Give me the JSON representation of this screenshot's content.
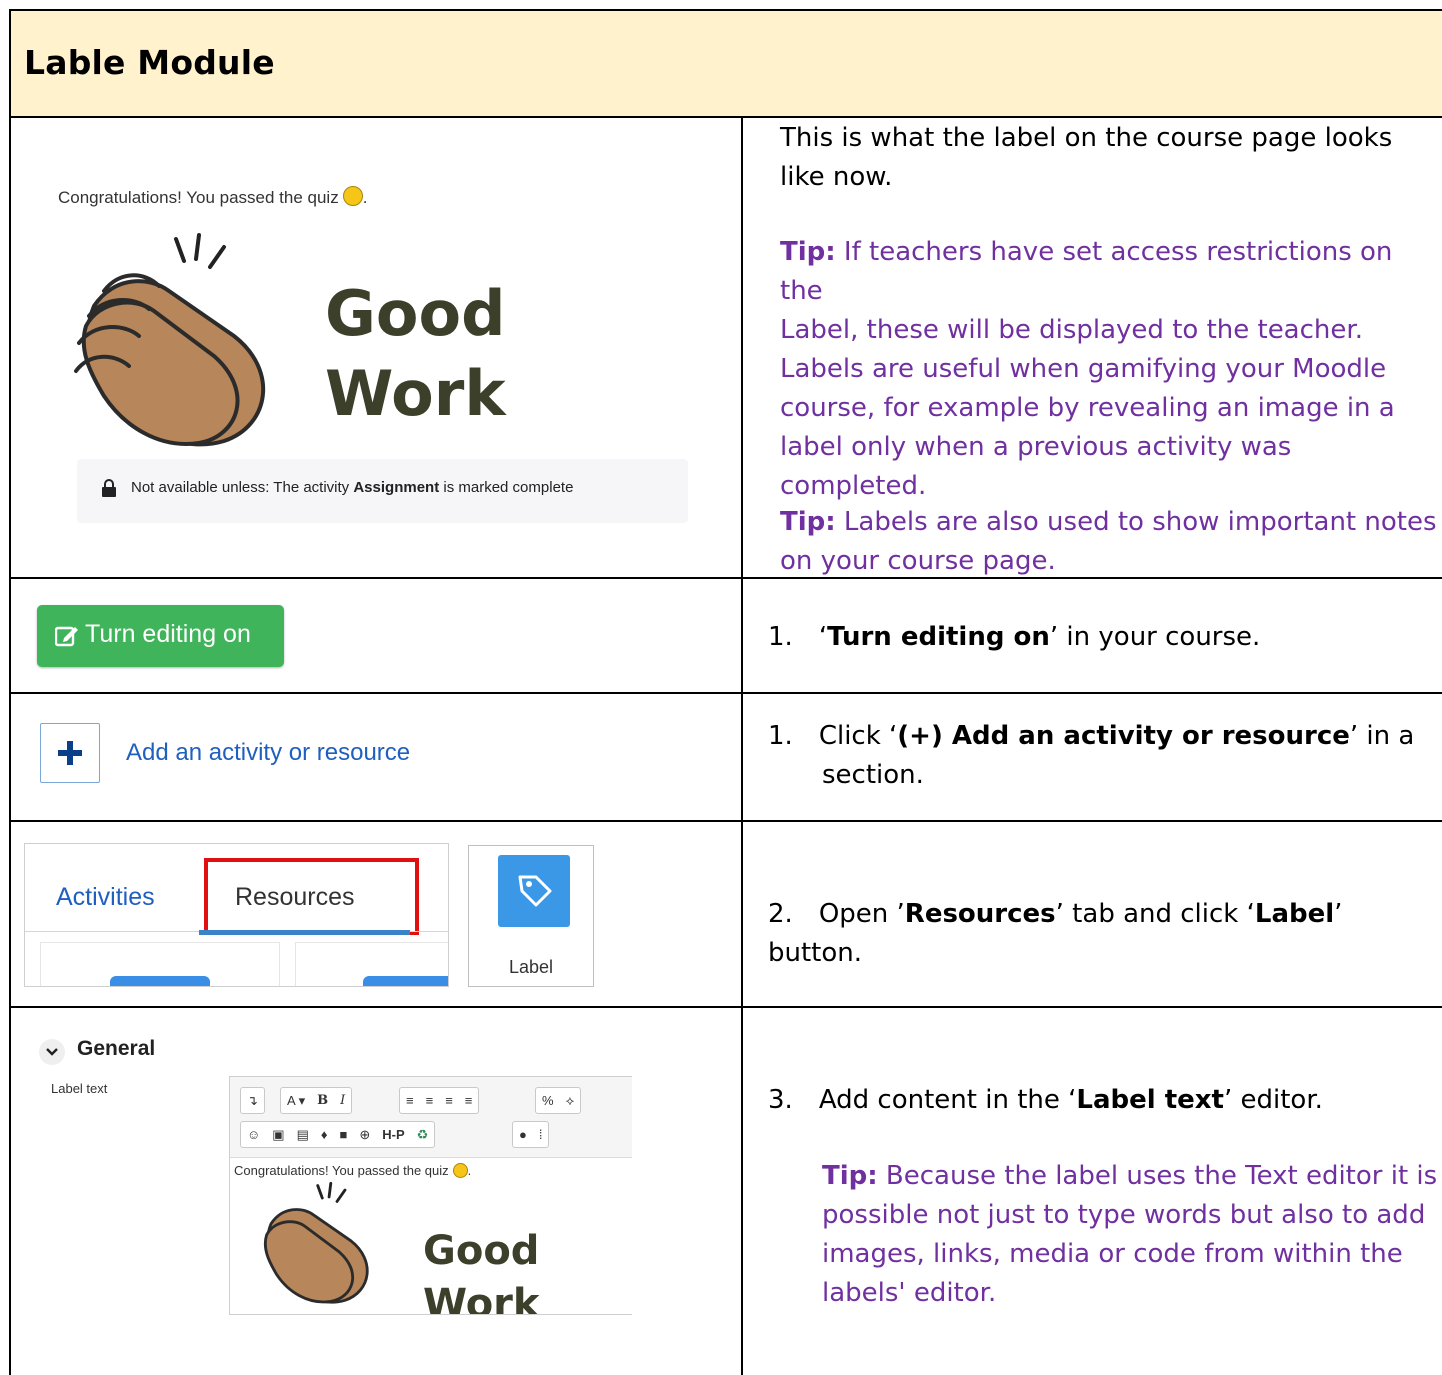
{
  "title": "Lable Module",
  "row1": {
    "screenshot": {
      "congrats": "Congratulations! You passed the quiz",
      "good": "Good",
      "work": "Work",
      "restriction_prefix": "Not available unless: The activity",
      "restriction_activity": "Assignment",
      "restriction_suffix": "is marked complete"
    },
    "text_l1": "This is what the label on the course page looks",
    "text_l2": "like now.",
    "tip1_label": "Tip:",
    "tip1_l1": "If teachers have set access restrictions on the",
    "tip1_l2": "Label, these will be displayed to the teacher.",
    "tip1_l3": "Labels are useful when gamifying your Moodle",
    "tip1_l4": "course, for example by revealing an image in a",
    "tip1_l5": "label only when a previous activity was",
    "tip1_l6": "completed.",
    "tip2_label": "Tip:",
    "tip2_l1": "Labels are also used to show important notes",
    "tip2_l2": "on your course page."
  },
  "row2": {
    "button_label": "Turn editing on",
    "step_num": "1.",
    "step_open": "‘",
    "step_bold": "Turn editing on",
    "step_rest": "’ in your course."
  },
  "row3": {
    "link_label": "Add an activity or resource",
    "step_num": "1.",
    "step_pre": "Click ‘",
    "step_bold": "(+) Add an activity or resource",
    "step_rest": "’ in a",
    "step_l2": "section."
  },
  "row4": {
    "tab_activities": "Activities",
    "tab_resources": "Resources",
    "label_button": "Label",
    "step_num": "2.",
    "step_pre": "Open ’",
    "step_bold1": "Resources",
    "step_mid": "’ tab and click ‘",
    "step_bold2": "Label",
    "step_rest": "’ button."
  },
  "row5": {
    "general": "General",
    "label_text": "Label text",
    "toolbar1": [
      "↴",
      "A ▾",
      "B",
      "I",
      "☰",
      "☷",
      "⇤",
      "⇥",
      "🔗",
      "⛓"
    ],
    "editor_congrats": "Congratulations! You passed the quiz",
    "good": "Good",
    "work": "Work",
    "h5p": "H-P",
    "step_num": "3.",
    "step_pre": "Add content in the ‘",
    "step_bold": "Label text",
    "step_rest": "’ editor.",
    "tip_label": "Tip:",
    "tip_l1": "Because the label uses the Text editor it is",
    "tip_l2": "possible not just to type words but also to add",
    "tip_l3": "images, links, media or code from within the",
    "tip_l4": "labels' editor."
  },
  "colors": {
    "header_bg": "#fff2cc",
    "tip": "#7030a0",
    "edit_button": "#3fb45a",
    "link": "#1f5fbf",
    "highlight": "#e01010",
    "tile": "#3a98e6"
  }
}
